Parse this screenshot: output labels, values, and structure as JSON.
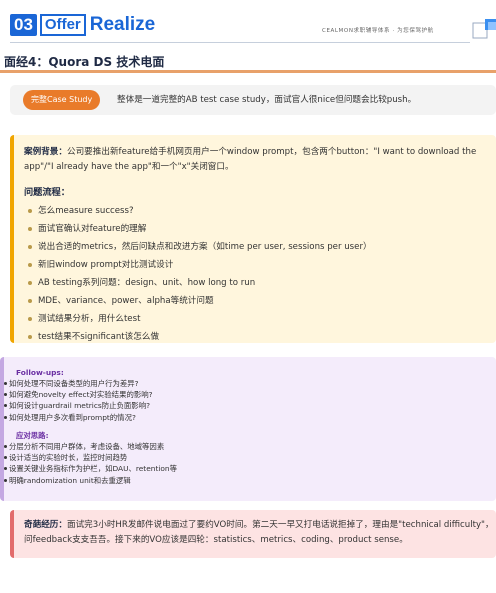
{
  "header": {
    "logo_number": "03",
    "logo_offer": "Offer",
    "logo_realize": "Realize",
    "tagline": "CEALMON求职辅导体系 · 为您保驾护航",
    "icon": "document-corner-icon"
  },
  "title": "面经4：Quora DS 技术电面",
  "summary": {
    "badge": "完整Case Study",
    "text": "整体是一道完整的AB test case study，面试官人很nice但问题会比较push。"
  },
  "background": {
    "label": "案例背景：",
    "text": "公司要推出新feature给手机网页用户一个window prompt，包含两个button：\"I want to download the app\"/\"I already have the app\"和一个\"x\"关闭窗口。"
  },
  "flow": {
    "heading": "问题流程：",
    "items": [
      "怎么measure success?",
      "面试官确认对feature的理解",
      "说出合适的metrics，然后问缺点和改进方案（如time per user, sessions per user）",
      "新旧window prompt对比测试设计",
      "AB testing系列问题：design、unit、how long to run",
      "MDE、variance、power、alpha等统计问题",
      "测试结果分析，用什么test",
      "test结果不significant该怎么做"
    ]
  },
  "followups": {
    "heading": "Follow-ups:",
    "items": [
      "如何处理不同设备类型的用户行为差异?",
      "如何避免novelty effect对实验结果的影响?",
      "如何设计guardrail metrics防止负面影响?",
      "如何处理用户多次看到prompt的情况?"
    ],
    "solutions_heading": "应对思路:",
    "solutions": [
      "分层分析不同用户群体，考虑设备、地域等因素",
      "设计适当的实验时长，监控时间趋势",
      "设置关键业务指标作为护栏，如DAU、retention等",
      "明确randomization unit和去重逻辑"
    ]
  },
  "odd": {
    "label": "奇葩经历：",
    "text": "面试完3小时HR发邮件说电面过了要约VO时间。第二天一早又打电话说拒掉了，理由是\"technical difficulty\"，问feedback支支吾吾。接下来的VO应该是四轮：statistics、metrics、coding、product sense。"
  },
  "colors": {
    "brand_blue": "#1a66d6",
    "badge_orange": "#e97b2a",
    "card2_bg": "#fff6dd",
    "card3_bg": "#f4ecfb",
    "card4_bg": "#fde3e3"
  }
}
